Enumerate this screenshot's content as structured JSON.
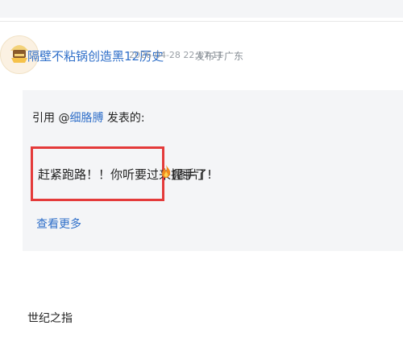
{
  "post": {
    "author": "隔壁不粘锅创造黑12历史",
    "timestamp": "2026-04-28 22:17:11",
    "location": "发布于广东"
  },
  "quote": {
    "prefix": "引用 @",
    "mentioned_user": "细胳膊",
    "suffix": " 发表的:",
    "text": "赶紧跑路！！你听要过来握手了!",
    "image_tag": "[图片]",
    "view_more": "查看更多"
  },
  "reply": {
    "text": "世纪之指"
  },
  "colors": {
    "link": "#2f6fc9",
    "highlight": "#e43a3a",
    "quote_bg": "#f4f5f7"
  },
  "icons": {
    "avatar": "cartoon-avatar",
    "emoji": "flame-icon"
  }
}
